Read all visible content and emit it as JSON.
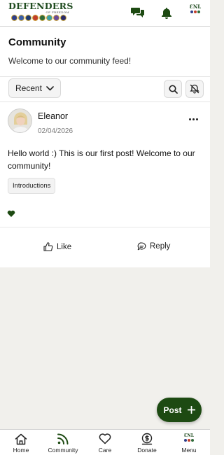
{
  "brand": {
    "name": "DEFENDERS",
    "tagline": "OF FREEDOM",
    "seal_colors": [
      "#2f3f8a",
      "#3b5fa8",
      "#1f3b73",
      "#c33e2a",
      "#2f6b3a",
      "#3aa0a8",
      "#6a4a9a",
      "#2a2a6a"
    ]
  },
  "header": {
    "mini_logo_text": "ƐNL",
    "mini_logo_colors": [
      "#2f3f8a",
      "#c33e2a",
      "#2f6b3a"
    ]
  },
  "page": {
    "title": "Community",
    "subtitle": "Welcome to our community feed!"
  },
  "filters": {
    "sort_label": "Recent"
  },
  "post": {
    "author": "Eleanor",
    "date": "02/04/2026",
    "body": "Hello world :) This is our first post! Welcome to our community!",
    "tag": "Introductions",
    "like_label": "Like",
    "reply_label": "Reply"
  },
  "fab": {
    "label": "Post"
  },
  "nav": {
    "items": [
      {
        "label": "Home",
        "icon": "home-icon"
      },
      {
        "label": "Community",
        "icon": "rss-icon"
      },
      {
        "label": "Care",
        "icon": "heart-icon"
      },
      {
        "label": "Donate",
        "icon": "dollar-icon"
      },
      {
        "label": "Menu",
        "icon": "menu-logo-icon"
      }
    ]
  },
  "colors": {
    "accent": "#1d4a12",
    "background": "#f1f0ec"
  }
}
